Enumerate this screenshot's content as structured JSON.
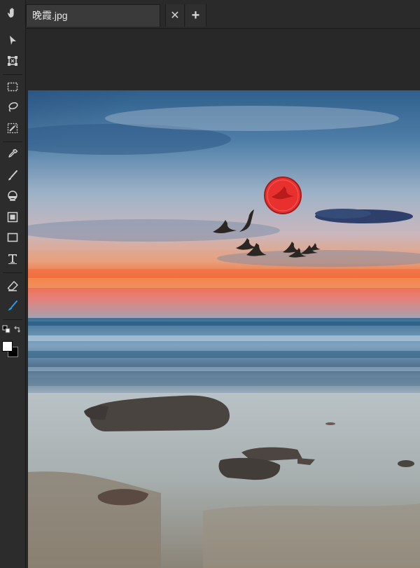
{
  "document": {
    "tab_title": "晚霞.jpg",
    "close_symbol": "✕",
    "add_symbol": "+"
  },
  "tools": [
    {
      "name": "hand-tool",
      "icon": "hand-icon"
    },
    {
      "name": "select-tool",
      "icon": "arrow-cursor-icon"
    },
    {
      "name": "transform-tool",
      "icon": "transform-icon"
    },
    {
      "name": "marquee-tool",
      "icon": "marquee-icon"
    },
    {
      "name": "lasso-tool",
      "icon": "lasso-icon"
    },
    {
      "name": "magic-wand-tool",
      "icon": "magic-wand-icon"
    },
    {
      "name": "eyedropper-tool",
      "icon": "eyedropper-icon"
    },
    {
      "name": "brush-tool",
      "icon": "brush-icon"
    },
    {
      "name": "stamp-tool",
      "icon": "stamp-icon"
    },
    {
      "name": "fill-tool",
      "icon": "fill-icon"
    },
    {
      "name": "shape-tool",
      "icon": "rectangle-icon"
    },
    {
      "name": "text-tool",
      "icon": "text-icon"
    },
    {
      "name": "eraser-tool",
      "icon": "eraser-icon"
    },
    {
      "name": "smudge-tool",
      "icon": "smudge-icon",
      "active": true
    }
  ],
  "colors": {
    "foreground": "#ffffff",
    "background": "#000000",
    "active_tool": "#2f9be8",
    "marker": "#e8312f"
  }
}
